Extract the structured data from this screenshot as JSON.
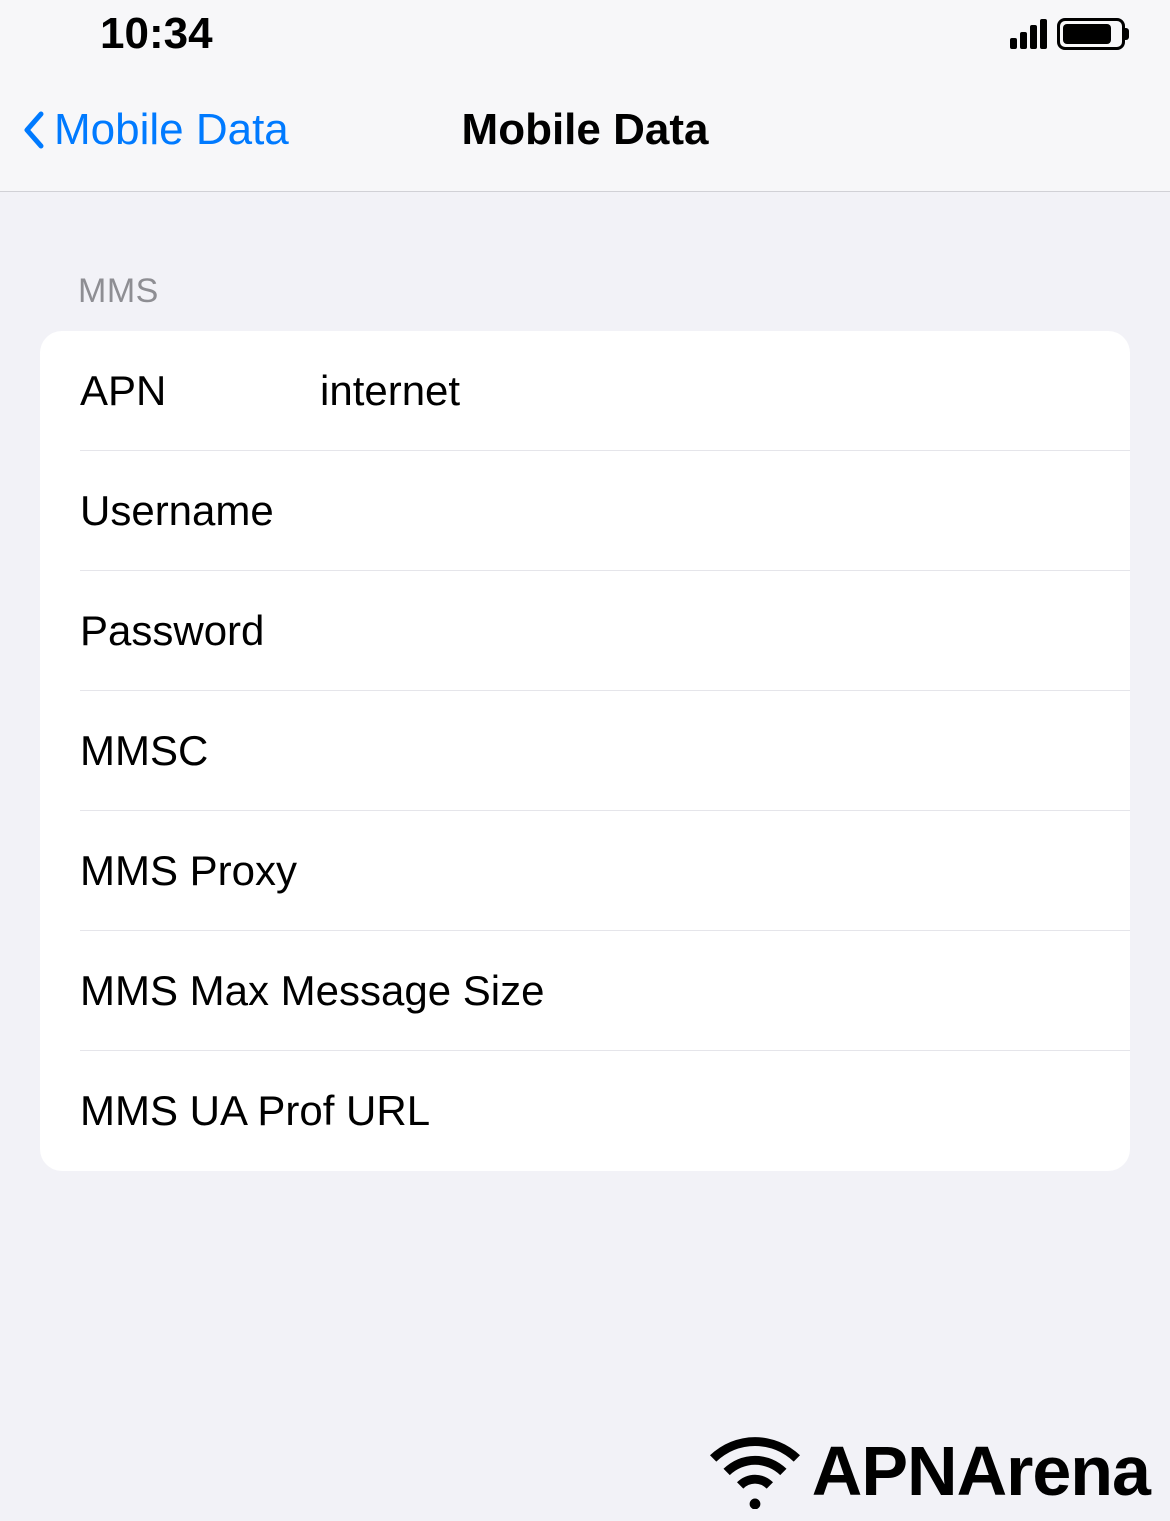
{
  "status": {
    "time": "10:34"
  },
  "nav": {
    "back_label": "Mobile Data",
    "title": "Mobile Data"
  },
  "section": {
    "header": "MMS"
  },
  "fields": {
    "apn": {
      "label": "APN",
      "value": "internet"
    },
    "username": {
      "label": "Username",
      "value": ""
    },
    "password": {
      "label": "Password",
      "value": ""
    },
    "mmsc": {
      "label": "MMSC",
      "value": ""
    },
    "mms_proxy": {
      "label": "MMS Proxy",
      "value": ""
    },
    "mms_max": {
      "label": "MMS Max Message Size",
      "value": ""
    },
    "mms_ua": {
      "label": "MMS UA Prof URL",
      "value": ""
    }
  },
  "brand": {
    "text": "APNArena"
  }
}
